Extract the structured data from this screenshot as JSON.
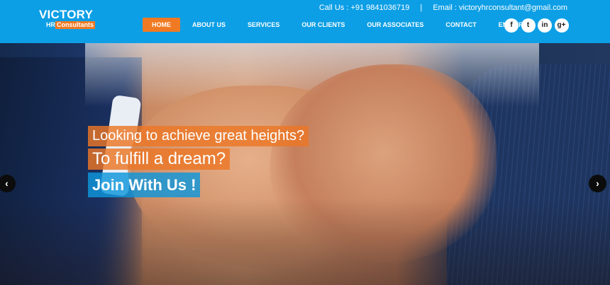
{
  "brand": {
    "name": "VICTORY",
    "sub_hr": "HR",
    "sub_consultants": "Consultants"
  },
  "contact": {
    "call": "Call Us : +91 9841036719",
    "separator": "|",
    "email": "Email : victoryhrconsultant@gmail.com"
  },
  "nav": {
    "items": [
      {
        "label": "HOME",
        "active": true
      },
      {
        "label": "ABOUT US"
      },
      {
        "label": "SERVICES"
      },
      {
        "label": "OUR CLIENTS"
      },
      {
        "label": "OUR ASSOCIATES"
      },
      {
        "label": "CONTACT"
      },
      {
        "label": "ENQUIRY"
      }
    ]
  },
  "socials": [
    {
      "icon": "facebook-icon",
      "glyph": "f"
    },
    {
      "icon": "twitter-icon",
      "glyph": "t"
    },
    {
      "icon": "linkedin-icon",
      "glyph": "in"
    },
    {
      "icon": "google-plus-icon",
      "glyph": "g+"
    }
  ],
  "hero": {
    "caption1": "Looking to achieve great heights?",
    "caption2": "To fulfill a dream?",
    "caption3": "Join With Us !",
    "prev_glyph": "‹",
    "next_glyph": "›"
  },
  "colors": {
    "header_bg": "#0d9fe6",
    "accent_orange": "#f07a23",
    "accent_blue": "#0e96dc"
  }
}
